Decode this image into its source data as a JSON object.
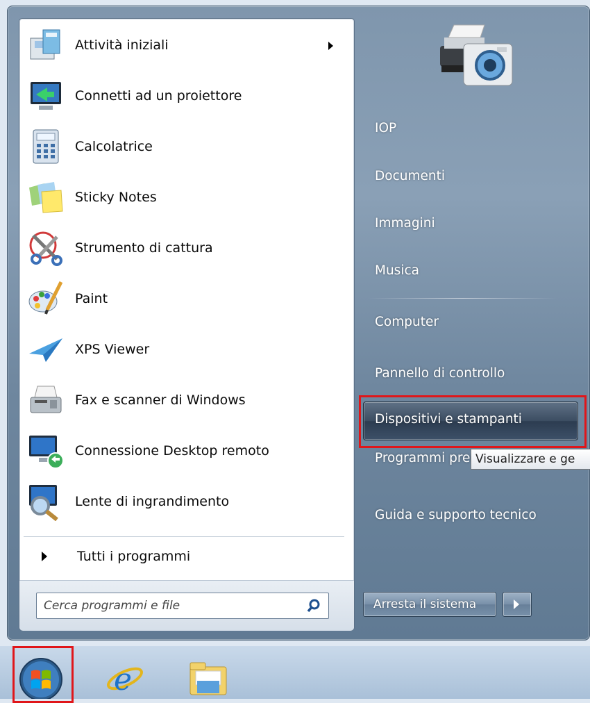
{
  "left_programs": [
    {
      "label": "Attività iniziali",
      "icon": "getting-started-icon",
      "has_submenu": true
    },
    {
      "label": "Connetti ad un proiettore",
      "icon": "projector-icon"
    },
    {
      "label": "Calcolatrice",
      "icon": "calculator-icon"
    },
    {
      "label": "Sticky Notes",
      "icon": "sticky-notes-icon"
    },
    {
      "label": "Strumento di cattura",
      "icon": "snipping-tool-icon"
    },
    {
      "label": "Paint",
      "icon": "paint-palette-icon"
    },
    {
      "label": "XPS Viewer",
      "icon": "xps-viewer-icon"
    },
    {
      "label": "Fax e scanner di Windows",
      "icon": "fax-scanner-icon"
    },
    {
      "label": "Connessione Desktop remoto",
      "icon": "remote-desktop-icon"
    },
    {
      "label": "Lente di ingrandimento",
      "icon": "magnifier-icon"
    }
  ],
  "all_programs_label": "Tutti i programmi",
  "search": {
    "placeholder": "Cerca programmi e file"
  },
  "right_items": [
    {
      "label": "IOP"
    },
    {
      "label": "Documenti"
    },
    {
      "label": "Immagini"
    },
    {
      "label": "Musica"
    },
    {
      "label": "Computer"
    },
    {
      "label": "Pannello di controllo"
    },
    {
      "label": "Dispositivi e stampanti",
      "highlighted": true
    },
    {
      "label": "Programmi predefiniti"
    },
    {
      "label": "Guida e supporto tecnico"
    }
  ],
  "tooltip": "Visualizzare e ge",
  "shutdown_label": "Arresta il sistema",
  "taskbar": [
    "start-orb-icon",
    "internet-explorer-icon",
    "windows-explorer-icon"
  ],
  "colors": {
    "highlight_box": "#e0161a",
    "menu_bg": "#7f96ad"
  }
}
